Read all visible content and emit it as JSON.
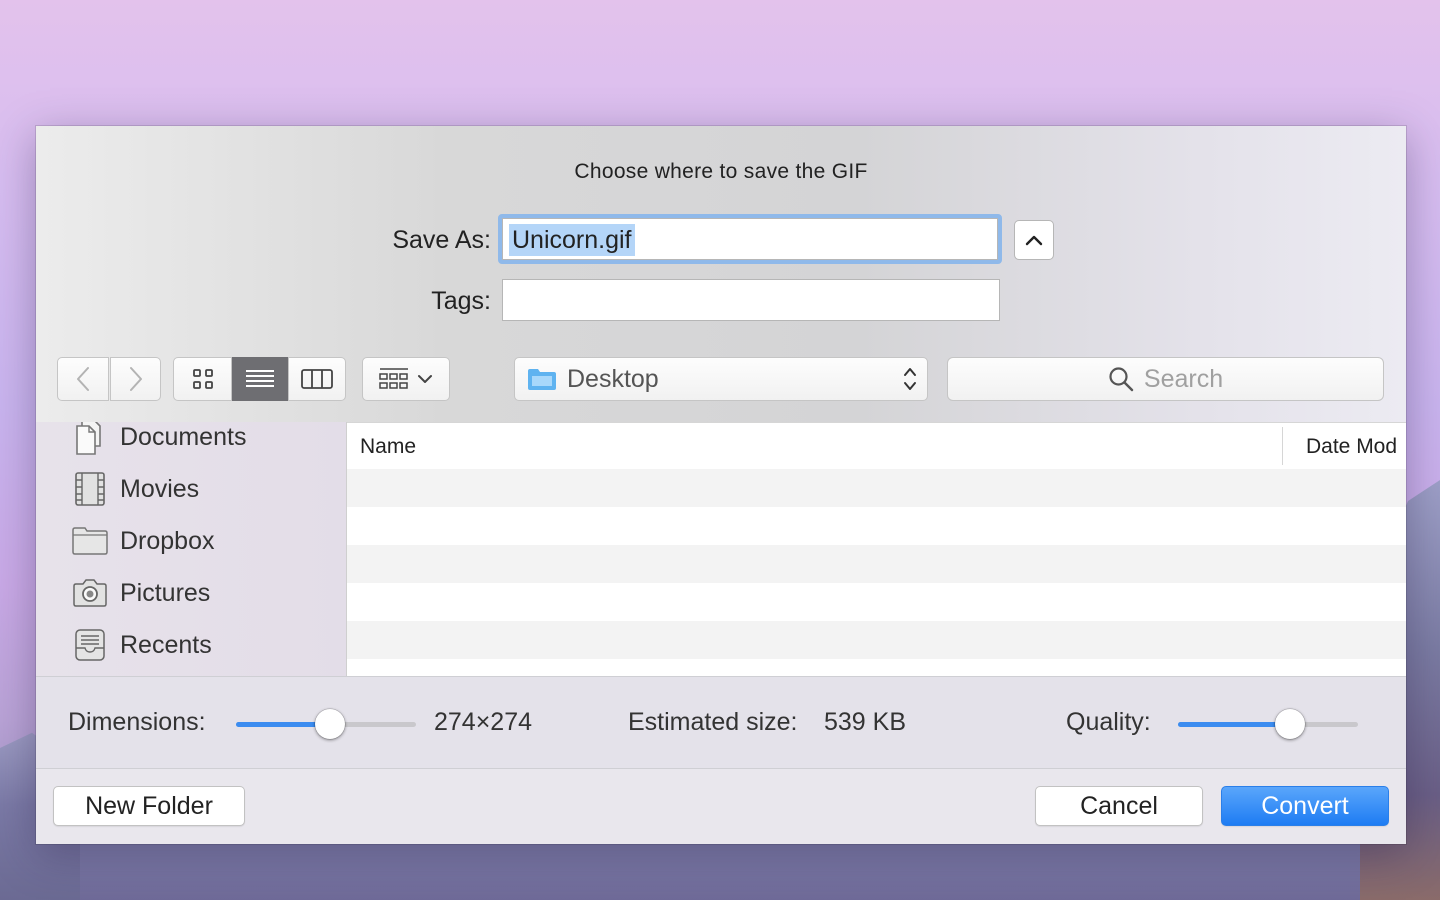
{
  "dialog": {
    "title": "Choose where to save the GIF",
    "save_as_label": "Save As:",
    "save_as_value": "Unicorn.gif",
    "tags_label": "Tags:",
    "tags_value": ""
  },
  "toolbar": {
    "location": "Desktop",
    "search_placeholder": "Search",
    "active_view": "list"
  },
  "sidebar": {
    "items": [
      {
        "label": "Documents",
        "icon": "documents-icon"
      },
      {
        "label": "Movies",
        "icon": "movies-icon"
      },
      {
        "label": "Dropbox",
        "icon": "folder-icon"
      },
      {
        "label": "Pictures",
        "icon": "camera-icon"
      },
      {
        "label": "Recents",
        "icon": "recents-icon"
      }
    ]
  },
  "file_list": {
    "columns": [
      "Name",
      "Date Mod"
    ],
    "rows": []
  },
  "options": {
    "dimensions_label": "Dimensions:",
    "dimensions_value": "274×274",
    "dimensions_slider": 0.52,
    "estimated_size_label": "Estimated size:",
    "estimated_size_value": "539 KB",
    "quality_label": "Quality:",
    "quality_slider": 0.62
  },
  "buttons": {
    "new_folder": "New Folder",
    "cancel": "Cancel",
    "convert": "Convert"
  },
  "colors": {
    "accent": "#1e7cf3",
    "selection": "#b4d5f8"
  }
}
